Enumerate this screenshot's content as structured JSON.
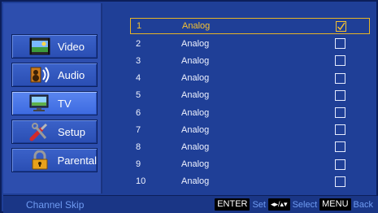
{
  "sidebar": {
    "items": [
      {
        "label": "Video",
        "icon": "video-icon",
        "active": false
      },
      {
        "label": "Audio",
        "icon": "audio-icon",
        "active": false
      },
      {
        "label": "TV",
        "icon": "tv-icon",
        "active": true
      },
      {
        "label": "Setup",
        "icon": "setup-icon",
        "active": false
      },
      {
        "label": "Parental",
        "icon": "lock-icon",
        "active": false
      }
    ]
  },
  "channels": [
    {
      "number": "1",
      "type": "Analog",
      "checked": true,
      "selected": true
    },
    {
      "number": "2",
      "type": "Analog",
      "checked": false,
      "selected": false
    },
    {
      "number": "3",
      "type": "Analog",
      "checked": false,
      "selected": false
    },
    {
      "number": "4",
      "type": "Analog",
      "checked": false,
      "selected": false
    },
    {
      "number": "5",
      "type": "Analog",
      "checked": false,
      "selected": false
    },
    {
      "number": "6",
      "type": "Analog",
      "checked": false,
      "selected": false
    },
    {
      "number": "7",
      "type": "Analog",
      "checked": false,
      "selected": false
    },
    {
      "number": "8",
      "type": "Analog",
      "checked": false,
      "selected": false
    },
    {
      "number": "9",
      "type": "Analog",
      "checked": false,
      "selected": false
    },
    {
      "number": "10",
      "type": "Analog",
      "checked": false,
      "selected": false
    }
  ],
  "footer": {
    "title": "Channel Skip",
    "enter_key": "ENTER",
    "enter_action": "Set",
    "select_key": "◂▸/▴▾",
    "select_action": "Select",
    "menu_key": "MENU",
    "menu_action": "Back"
  },
  "colors": {
    "background": "#1f3f97",
    "highlight": "#e7b426",
    "active_button": "#4a78ea",
    "footer_text": "#6f9bf2"
  }
}
